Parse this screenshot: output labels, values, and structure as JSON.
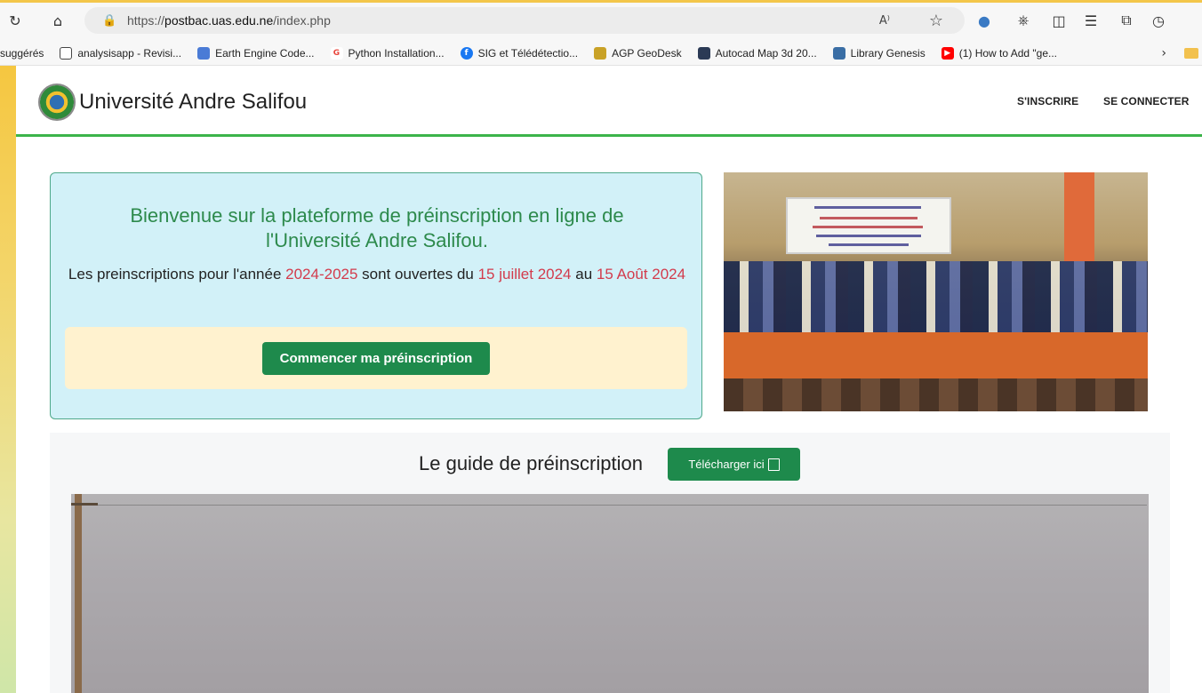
{
  "browser": {
    "url_prefix": "https://",
    "url_domain": "postbac.uas.edu.ne",
    "url_path": "/index.php",
    "read_aloud_label": "A⁾",
    "bookmarks": [
      {
        "label": "suggérés",
        "icon": "none"
      },
      {
        "label": "analysisapp - Revisi...",
        "icon": "page-icon",
        "color": "#444444"
      },
      {
        "label": "Earth Engine Code...",
        "icon": "earth-engine-icon",
        "color": "#4a7bd6"
      },
      {
        "label": "Python Installation...",
        "icon": "google-icon",
        "color": "#e8453c"
      },
      {
        "label": "SIG et Télédétectio...",
        "icon": "facebook-icon",
        "color": "#1877f2"
      },
      {
        "label": "AGP GeoDesk",
        "icon": "geodesk-icon",
        "color": "#c9a227"
      },
      {
        "label": "Autocad Map 3d 20...",
        "icon": "autocad-icon",
        "color": "#2b3a55"
      },
      {
        "label": "Library Genesis",
        "icon": "library-icon",
        "color": "#3a6ea5"
      },
      {
        "label": "(1) How to Add \"ge...",
        "icon": "youtube-icon",
        "color": "#ff0000"
      }
    ]
  },
  "site": {
    "brand": "Université Andre Salifou",
    "nav": {
      "register": "S'INSCRIRE",
      "login": "SE CONNECTER"
    }
  },
  "welcome": {
    "title": "Bienvenue sur la plateforme de préinscription en ligne de l'Université Andre Salifou.",
    "text_1": "Les preinscriptions pour l'année ",
    "year": "2024-2025",
    "text_2": " sont ouvertes du ",
    "start_date": "15 juillet 2024",
    "text_3": " au ",
    "end_date": "15 Août 2024",
    "button": "Commencer ma préinscription"
  },
  "guide": {
    "label": "Le guide de préinscription",
    "button": "Télécharger ici"
  },
  "colors": {
    "accent_green": "#1e8a4c",
    "title_green": "#2d8a4c",
    "highlight_red": "#d33b4c",
    "card_blue": "#d2f1f8",
    "inner_cream": "#fff2cf",
    "nav_rule": "#3cb44a"
  }
}
